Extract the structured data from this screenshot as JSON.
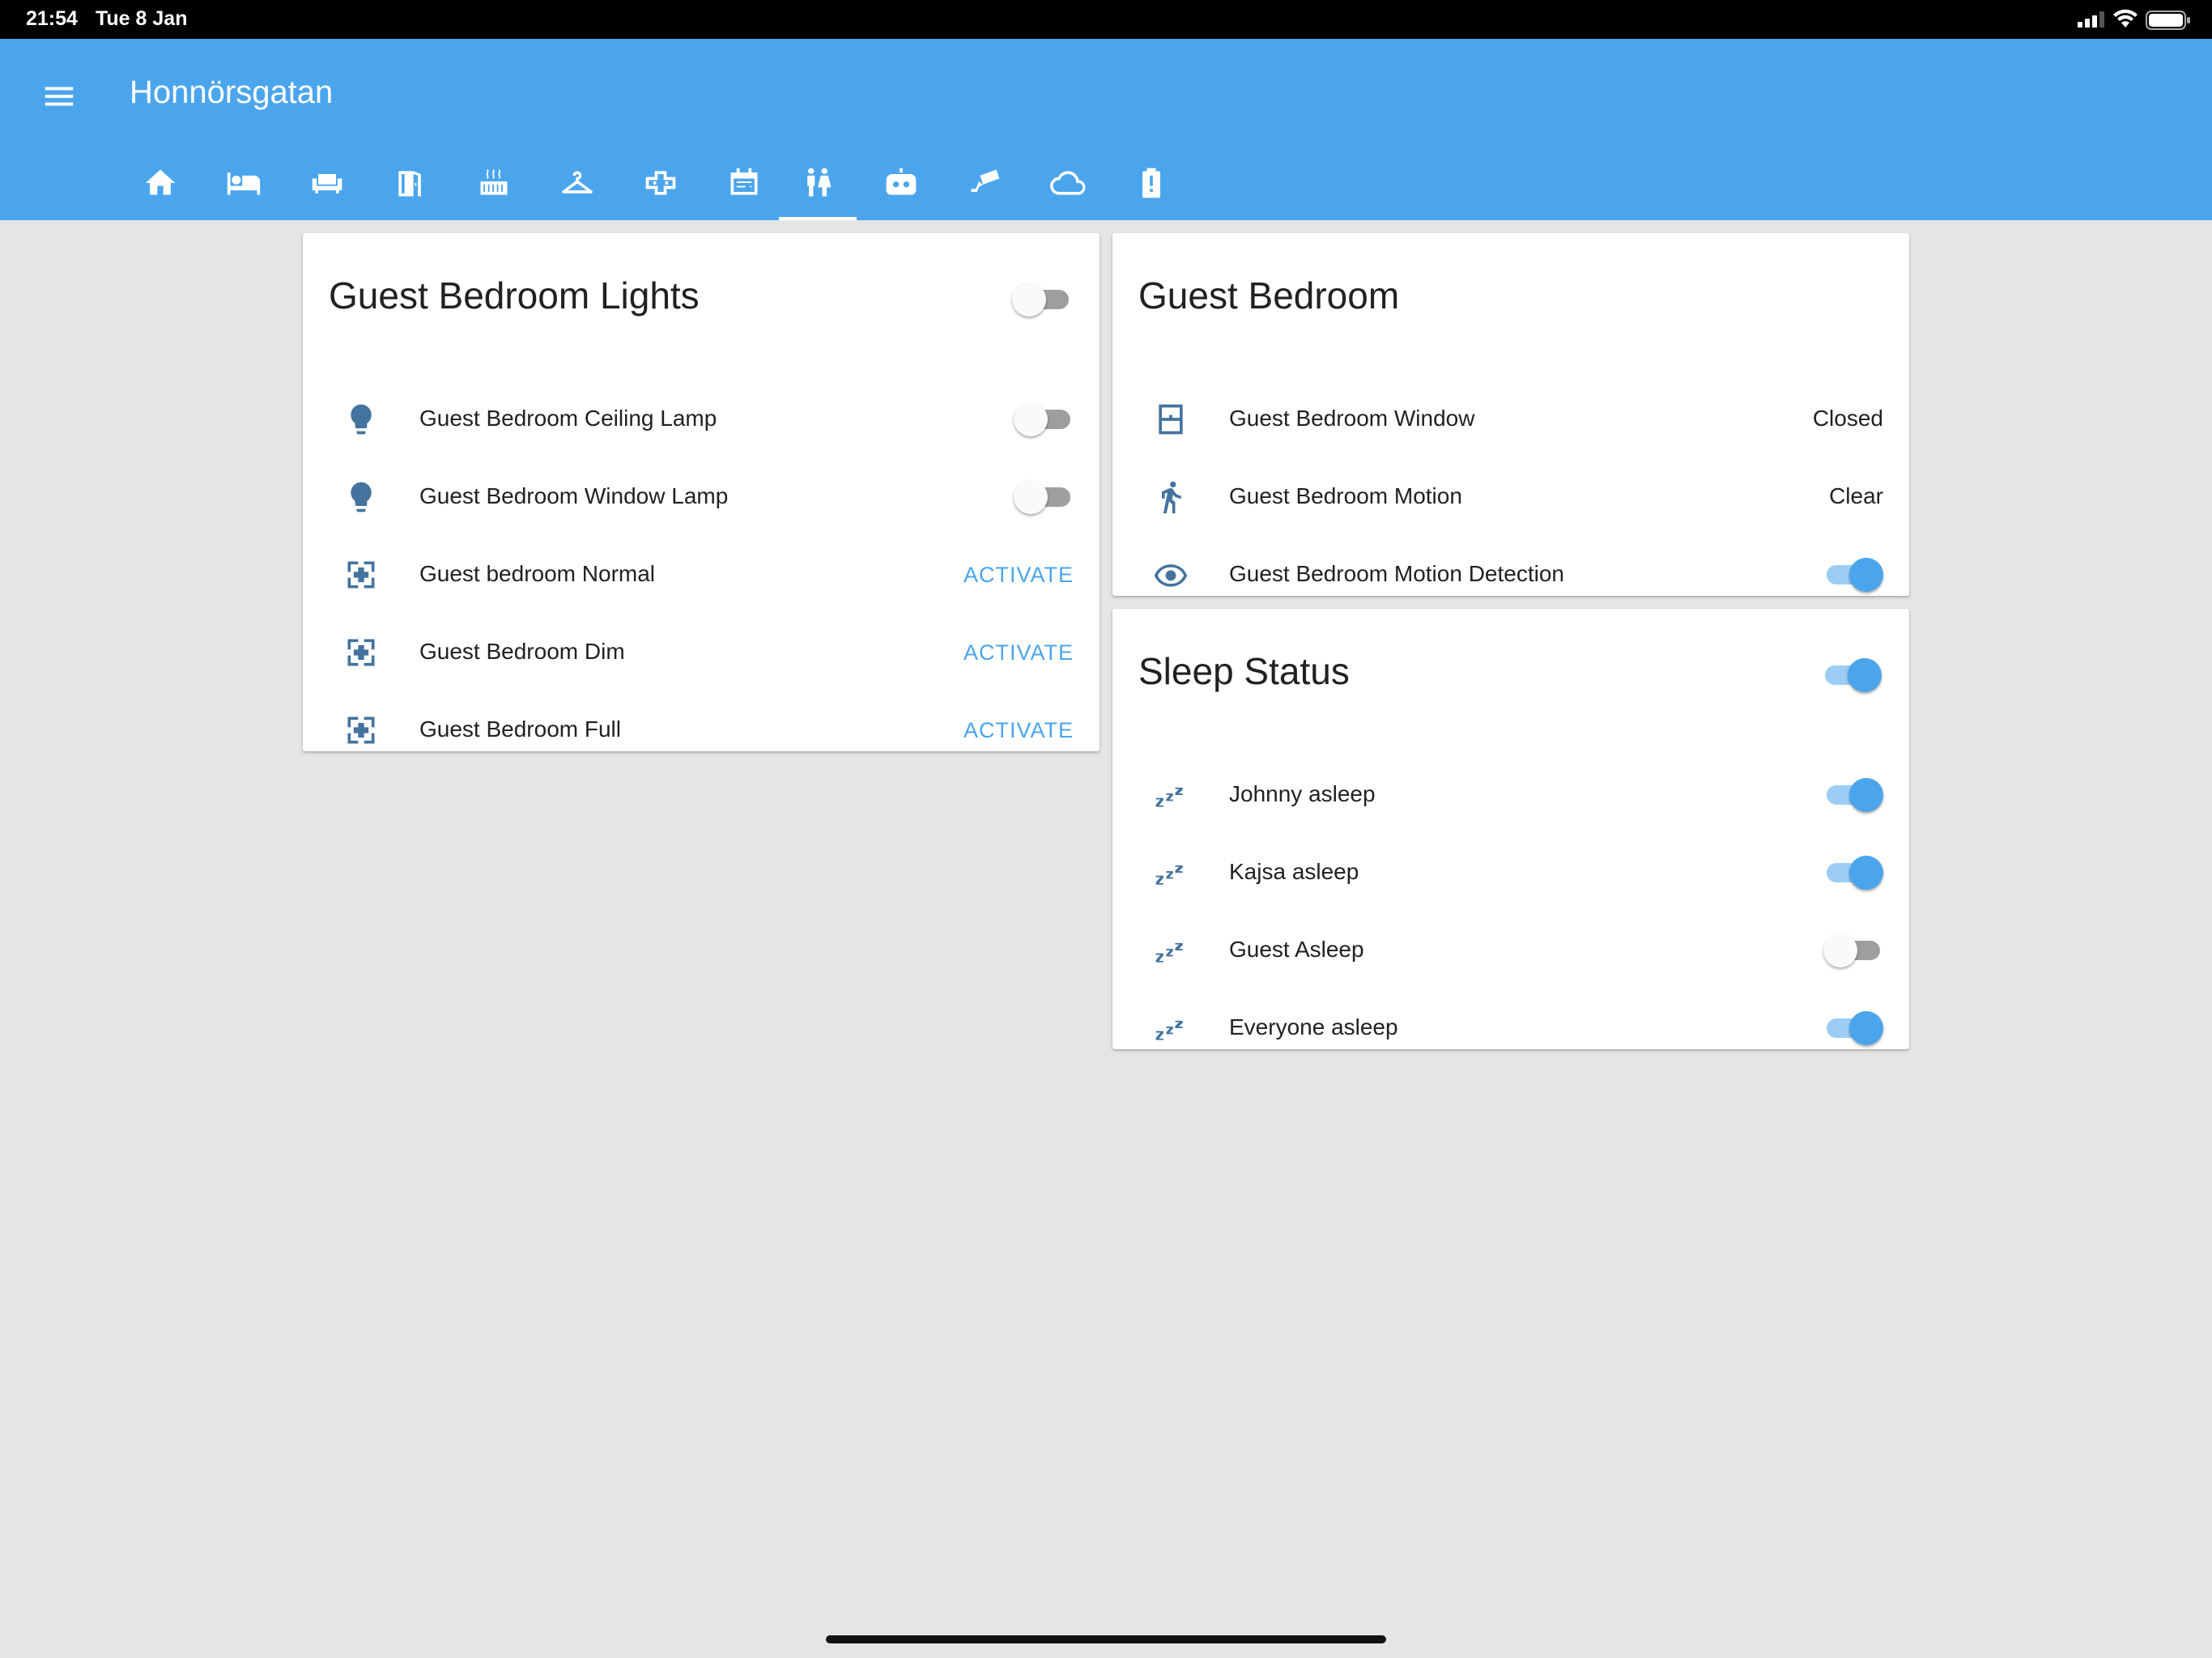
{
  "status_bar": {
    "time": "21:54",
    "date": "Tue 8 Jan"
  },
  "header": {
    "title": "Honnörsgatan",
    "menu_icon": "hamburger-menu-icon"
  },
  "tabs": [
    {
      "icon": "home-icon"
    },
    {
      "icon": "bed-icon"
    },
    {
      "icon": "sofa-icon"
    },
    {
      "icon": "door-icon"
    },
    {
      "icon": "radiator-icon"
    },
    {
      "icon": "hanger-icon"
    },
    {
      "icon": "garage-icon"
    },
    {
      "icon": "calendar-icon"
    },
    {
      "icon": "people-icon",
      "active": true
    },
    {
      "icon": "robot-icon"
    },
    {
      "icon": "camera-icon"
    },
    {
      "icon": "cloud-icon"
    },
    {
      "icon": "battery-icon"
    }
  ],
  "lights_card": {
    "title": "Guest Bedroom Lights",
    "master_on": false,
    "rows": [
      {
        "label": "Guest Bedroom Ceiling Lamp",
        "icon": "lightbulb-icon",
        "on": false
      },
      {
        "label": "Guest Bedroom Window Lamp",
        "icon": "lightbulb-icon",
        "on": false
      },
      {
        "label": "Guest bedroom Normal",
        "icon": "scene-icon",
        "action": "ACTIVATE"
      },
      {
        "label": "Guest Bedroom Dim",
        "icon": "scene-icon",
        "action": "ACTIVATE"
      },
      {
        "label": "Guest Bedroom Full",
        "icon": "scene-icon",
        "action": "ACTIVATE"
      }
    ]
  },
  "bedroom_card": {
    "title": "Guest Bedroom",
    "rows": [
      {
        "label": "Guest Bedroom Window",
        "icon": "window-icon",
        "value": "Closed"
      },
      {
        "label": "Guest Bedroom Motion",
        "icon": "walking-icon",
        "value": "Clear"
      },
      {
        "label": "Guest Bedroom Motion Detection",
        "icon": "eye-icon",
        "on": true
      }
    ]
  },
  "sleep_card": {
    "title": "Sleep Status",
    "master_on": true,
    "rows": [
      {
        "label": "Johnny asleep",
        "icon": "sleep-icon",
        "on": true
      },
      {
        "label": "Kajsa asleep",
        "icon": "sleep-icon",
        "on": true
      },
      {
        "label": "Guest Asleep",
        "icon": "sleep-icon",
        "on": false
      },
      {
        "label": "Everyone asleep",
        "icon": "sleep-icon",
        "on": true
      }
    ]
  },
  "colors": {
    "primary": "#4ba5ec",
    "icon": "#44739e",
    "background": "#e5e5e5"
  }
}
